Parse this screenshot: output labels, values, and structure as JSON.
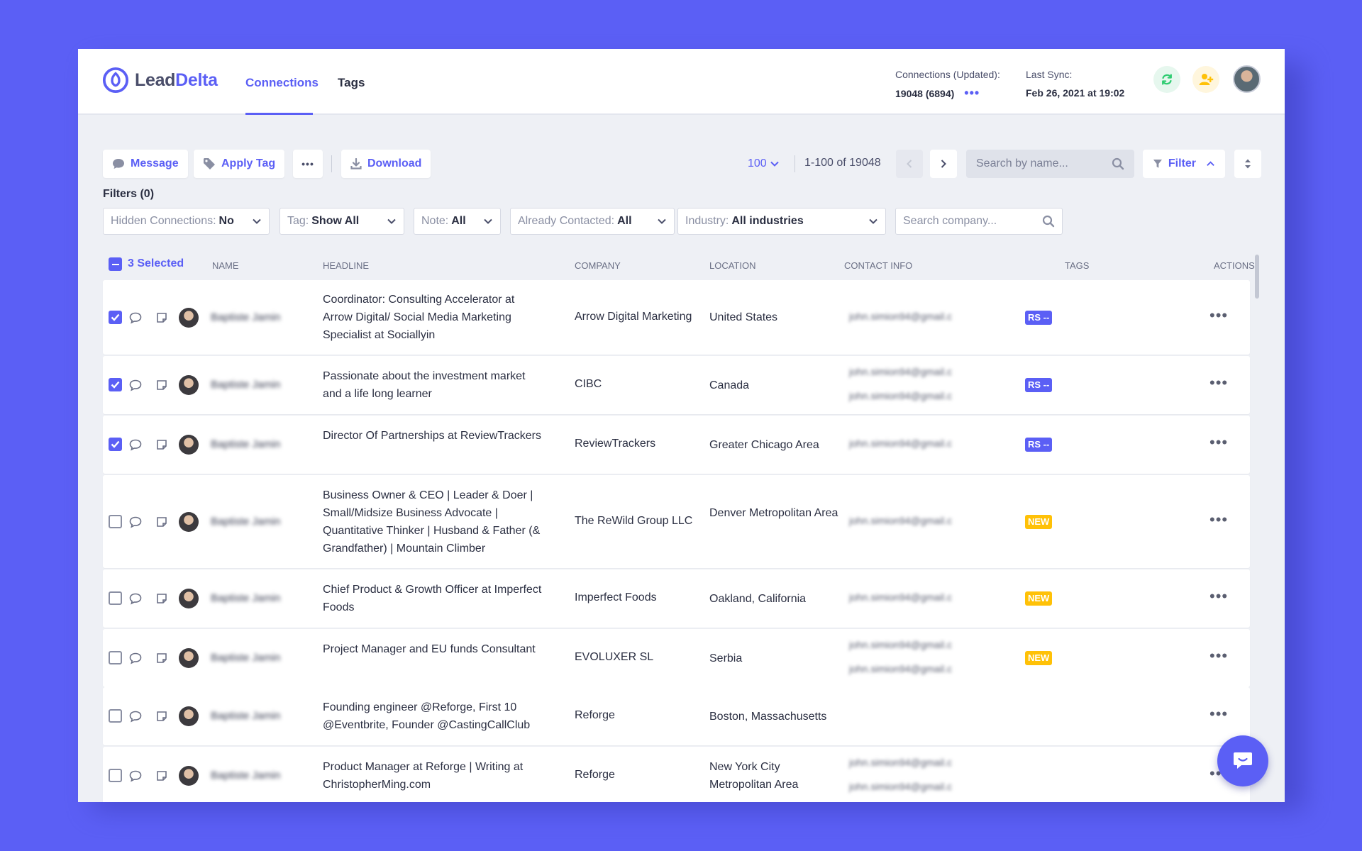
{
  "app": {
    "brand_lead": "Lead",
    "brand_delta": "Delta"
  },
  "nav": {
    "tabs": [
      {
        "label": "Connections",
        "active": true
      },
      {
        "label": "Tags",
        "active": false
      }
    ]
  },
  "header": {
    "connections_label": "Connections (Updated):",
    "connections_value": "19048 (6894)",
    "connections_more": "•••",
    "sync_label": "Last Sync:",
    "sync_value": "Feb 26, 2021 at 19:02"
  },
  "toolbar": {
    "message": "Message",
    "apply_tag": "Apply Tag",
    "more": "•••",
    "download": "Download",
    "per_page": "100",
    "range": "1-100 of 19048",
    "search_placeholder": "Search by name...",
    "filter": "Filter"
  },
  "filters": {
    "label": "Filters (0)",
    "items": [
      {
        "label": "Hidden Connections:",
        "value": "No"
      },
      {
        "label": "Tag:",
        "value": "Show All"
      },
      {
        "label": "Note:",
        "value": "All"
      },
      {
        "label": "Already Contacted:",
        "value": "All"
      },
      {
        "label": "Industry:",
        "value": "All industries"
      }
    ],
    "company_placeholder": "Search company..."
  },
  "table": {
    "selected": "3 Selected",
    "columns": [
      "Name",
      "Headline",
      "Company",
      "Location",
      "Contact Info",
      "Tags",
      "Actions"
    ],
    "rows": [
      {
        "checked": true,
        "name": "Baptiste Jamin",
        "headline": "Coordinator: Consulting Accelerator at Arrow Digital/ Social Media Marketing Specialist at Sociallyin",
        "company": "Arrow Digital Marketing",
        "location": "United States",
        "contact": [
          "john.simion94@gmail.c"
        ],
        "tag": "RS --",
        "tag_type": "rs"
      },
      {
        "checked": true,
        "name": "Baptiste Jamin",
        "headline": "Passionate about the investment market and a life long learner",
        "company": "CIBC",
        "location": "Canada",
        "contact": [
          "john.simion94@gmail.c",
          "john.simion94@gmail.c"
        ],
        "tag": "RS --",
        "tag_type": "rs"
      },
      {
        "checked": true,
        "name": "Baptiste Jamin",
        "headline": "Director Of Partnerships at ReviewTrackers",
        "company": "ReviewTrackers",
        "location": "Greater Chicago Area",
        "contact": [
          "john.simion94@gmail.c"
        ],
        "tag": "RS --",
        "tag_type": "rs"
      },
      {
        "checked": false,
        "name": "Baptiste Jamin",
        "headline": "Business Owner & CEO | Leader & Doer | Small/Midsize Business Advocate | Quantitative Thinker | Husband & Father (& Grandfather) | Mountain Climber",
        "company": "The ReWild Group LLC",
        "location": "Denver Metropolitan Area",
        "contact": [
          "john.simion94@gmail.c"
        ],
        "tag": "NEW",
        "tag_type": "new"
      },
      {
        "checked": false,
        "name": "Baptiste Jamin",
        "headline": "Chief Product & Growth Officer at Imperfect Foods",
        "company": "Imperfect Foods",
        "location": "Oakland, California",
        "contact": [
          "john.simion94@gmail.c"
        ],
        "tag": "NEW",
        "tag_type": "new"
      },
      {
        "checked": false,
        "name": "Baptiste Jamin",
        "headline": "Project Manager and EU funds Consultant",
        "company": "EVOLUXER SL",
        "location": "Serbia",
        "contact": [
          "john.simion94@gmail.c",
          "john.simion94@gmail.c"
        ],
        "tag": "NEW",
        "tag_type": "new"
      },
      {
        "checked": false,
        "name": "Baptiste Jamin",
        "headline": "Founding engineer @Reforge, First 10 @Eventbrite, Founder @CastingCallClub",
        "company": "Reforge",
        "location": "Boston, Massachusetts",
        "contact": [],
        "tag": "",
        "tag_type": ""
      },
      {
        "checked": false,
        "name": "Baptiste Jamin",
        "headline": "Product Manager at Reforge | Writing at ChristopherMing.com",
        "company": "Reforge",
        "location": "New York City Metropolitan Area",
        "contact": [
          "john.simion94@gmail.c",
          "john.simion94@gmail.c"
        ],
        "tag": "",
        "tag_type": ""
      }
    ],
    "row_actions": "•••"
  },
  "colors": {
    "accent": "#5b5ff5",
    "tag_new": "#ffc107",
    "sync_green": "#2ecc71",
    "add_yellow": "#ffc107"
  }
}
